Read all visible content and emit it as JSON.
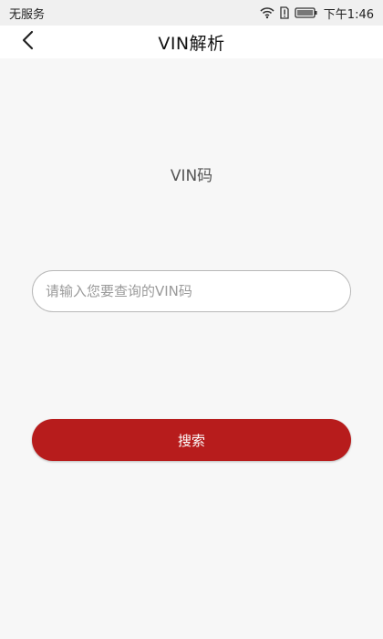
{
  "status_bar": {
    "carrier": "无服务",
    "time": "下午1:46",
    "icons": [
      "wifi-icon",
      "sim-alert-icon",
      "battery-icon"
    ]
  },
  "header": {
    "title": "VIN解析",
    "back_icon": "chevron-left-icon"
  },
  "main": {
    "vin_label": "VIN码",
    "vin_input": {
      "value": "",
      "placeholder": "请输入您要查询的VIN码"
    },
    "search_label": "搜索"
  },
  "colors": {
    "accent": "#b71c1c",
    "background": "#f7f7f7",
    "status_bar": "#f0f0f0",
    "header": "#ffffff"
  }
}
